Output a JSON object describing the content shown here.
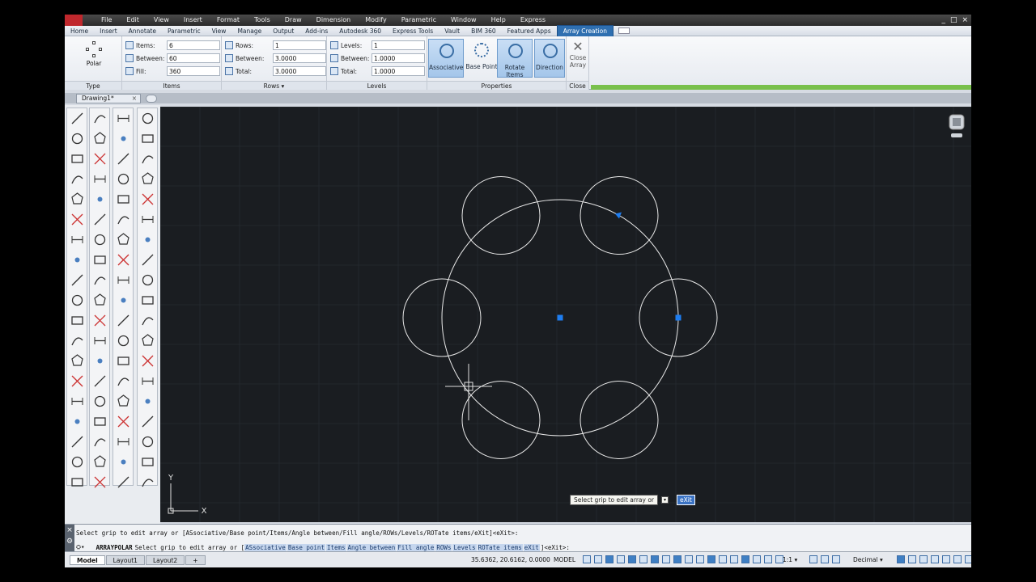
{
  "menubar": {
    "items": [
      "File",
      "Edit",
      "View",
      "Insert",
      "Format",
      "Tools",
      "Draw",
      "Dimension",
      "Modify",
      "Parametric",
      "Window",
      "Help",
      "Express"
    ],
    "controls": [
      "_",
      "□",
      "×"
    ]
  },
  "ribbon_tabs": {
    "tabs": [
      "Home",
      "Insert",
      "Annotate",
      "Parametric",
      "View",
      "Manage",
      "Output",
      "Add-ins",
      "Autodesk 360",
      "Express Tools",
      "Vault",
      "BIM 360",
      "Featured Apps",
      "Array Creation"
    ],
    "active": "Array Creation"
  },
  "ribbon": {
    "type_panel": {
      "button_label": "Polar",
      "title": "Type"
    },
    "items_panel": {
      "title": "Items",
      "items_label": "Items:",
      "items_value": "6",
      "between_label": "Between:",
      "between_value": "60",
      "fill_label": "Fill:",
      "fill_value": "360"
    },
    "rows_panel": {
      "title": "Rows ▾",
      "rows_label": "Rows:",
      "rows_value": "1",
      "between_label": "Between:",
      "between_value": "3.0000",
      "total_label": "Total:",
      "total_value": "3.0000"
    },
    "levels_panel": {
      "title": "Levels",
      "levels_label": "Levels:",
      "levels_value": "1",
      "between_label": "Between:",
      "between_value": "1.0000",
      "total_label": "Total:",
      "total_value": "1.0000"
    },
    "properties_panel": {
      "title": "Properties",
      "associative": "Associative",
      "base_point": "Base Point",
      "rotate_items": "Rotate Items",
      "direction": "Direction"
    },
    "close_panel": {
      "title": "Close",
      "close_label_1": "Close",
      "close_label_2": "Array"
    }
  },
  "document": {
    "tab": "Drawing1*",
    "close": "×"
  },
  "canvas": {
    "ucs_y": "Y",
    "ucs_x": "X",
    "colors": {
      "background": "#1a1d21",
      "geometry": "#e8e8e8",
      "grip": "#1e7df0",
      "grid": "#2b3036"
    }
  },
  "tooltip": {
    "text": "Select grip to edit array or",
    "exit": "eXit"
  },
  "command": {
    "history": "Select grip to edit array or [ASsociative/Base point/Items/Angle between/Fill angle/ROWs/Levels/ROTate items/eXit]<eXit>:",
    "name": "ARRAYPOLAR",
    "prompt": "Select grip to edit array or [",
    "options": [
      "ASsociative",
      "Base point",
      "Items",
      "Angle between",
      "Fill angle",
      "ROWs",
      "Levels",
      "ROTate items",
      "eXit"
    ],
    "suffix": "]<eXit>:"
  },
  "statusbar": {
    "layouts": [
      "Model",
      "Layout1",
      "Layout2"
    ],
    "coords": "35.6362, 20.6162, 0.0000",
    "space": "MODEL",
    "scale": "1:1 ▾",
    "units": "Decimal ▾"
  }
}
